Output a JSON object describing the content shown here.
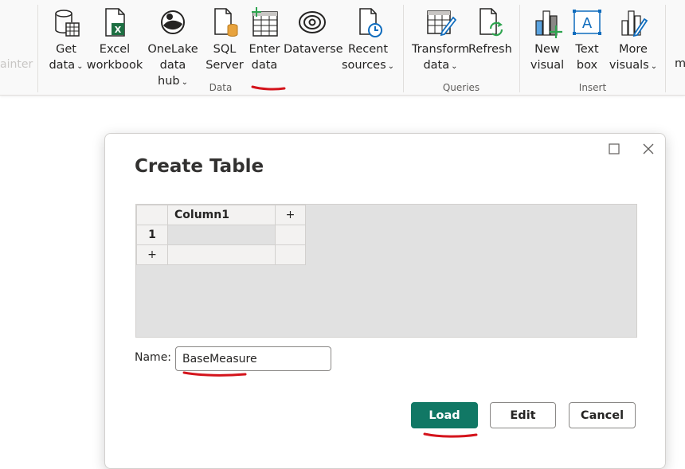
{
  "ribbon": {
    "ghost_text": "ainter",
    "buttons": {
      "get_data": [
        "Get",
        "data"
      ],
      "excel": [
        "Excel",
        "workbook"
      ],
      "onelake": [
        "OneLake",
        "data hub"
      ],
      "sql": [
        "SQL",
        "Server"
      ],
      "enter_data": [
        "Enter",
        "data"
      ],
      "dataverse": [
        "Dataverse"
      ],
      "recent": [
        "Recent",
        "sources"
      ],
      "transform": [
        "Transform",
        "data"
      ],
      "refresh": [
        "Refresh"
      ],
      "new_visual": [
        "New",
        "visual"
      ],
      "text_box": [
        "Text",
        "box"
      ],
      "more_visuals": [
        "More",
        "visuals"
      ],
      "cut_off": "m"
    },
    "groups": {
      "data": "Data",
      "queries": "Queries",
      "insert": "Insert"
    },
    "chevron": "⌄"
  },
  "dialog": {
    "title": "Create Table",
    "maximize_glyph": "□",
    "close_glyph": "✕",
    "table": {
      "column_header": "Column1",
      "add_column": "+",
      "row_number": "1",
      "add_row": "+"
    },
    "name_label": "Name:",
    "name_value": "BaseMeasure",
    "buttons": {
      "load": "Load",
      "edit": "Edit",
      "cancel": "Cancel"
    }
  },
  "colors": {
    "accent": "#117865",
    "annotation_red": "#d4141c"
  }
}
